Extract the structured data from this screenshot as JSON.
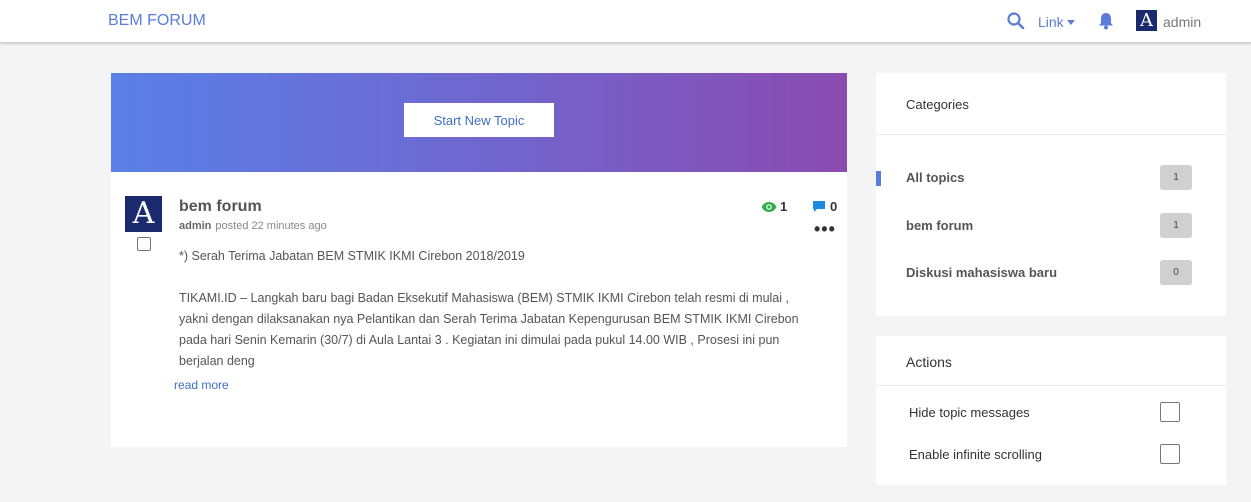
{
  "navbar": {
    "brand": "BEM FORUM",
    "link_label": "Link",
    "user_initial": "A",
    "username": "admin"
  },
  "main": {
    "new_topic_label": "Start New Topic",
    "topic": {
      "avatar_initial": "A",
      "title": "bem forum",
      "author": "admin",
      "posted": "posted 22 minutes ago",
      "views": "1",
      "comments": "0",
      "more": "•••",
      "paragraphs": [
        "*) Serah Terima Jabatan BEM STMIK IKMI Cirebon 2018/2019",
        "TIKAMI.ID – Langkah baru bagi Badan Eksekutif Mahasiswa (BEM) STMIK IKMI Cirebon telah resmi di mulai , yakni dengan dilaksanakan nya Pelantikan dan Serah Terima Jabatan Kepengurusan BEM STMIK IKMI Cirebon pada hari Senin Kemarin (30/7) di Aula Lantai 3 . Kegiatan ini dimulai pada pukul 14.00 WIB , Prosesi ini pun berjalan deng"
      ],
      "read_more": "read more"
    }
  },
  "sidebar": {
    "categories_heading": "Categories",
    "categories": [
      {
        "label": "All topics",
        "count": "1",
        "active": true
      },
      {
        "label": "bem forum",
        "count": "1",
        "active": false
      },
      {
        "label": "Diskusi mahasiswa baru",
        "count": "0",
        "active": false
      }
    ],
    "actions_heading": "Actions",
    "actions": [
      {
        "label": "Hide topic messages",
        "checked": false
      },
      {
        "label": "Enable infinite scrolling",
        "checked": false
      }
    ]
  },
  "colors": {
    "accent": "#5b7cd9",
    "avatar_bg": "#1a2a6c",
    "banner_start": "#5a80e8",
    "banner_end": "#8a4bb0",
    "views_icon": "#2bb04a",
    "comments_icon": "#1e88e5"
  },
  "icons": {
    "search": "search-icon",
    "bell": "bell-icon",
    "eye": "eye-icon",
    "comment": "comment-icon",
    "more": "more-dots-icon"
  }
}
